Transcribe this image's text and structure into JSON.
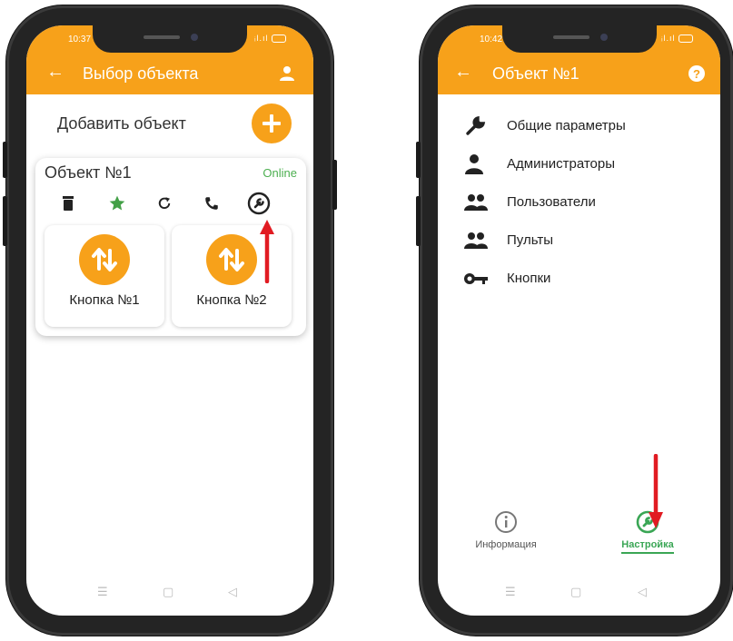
{
  "colors": {
    "accent": "#f7a11a",
    "online": "#4caf50",
    "active_tab": "#3aa655",
    "arrow": "#e11b22"
  },
  "left": {
    "status": {
      "time": "10:37"
    },
    "appbar": {
      "title": "Выбор объекта"
    },
    "add": {
      "label": "Добавить объект"
    },
    "object": {
      "name": "Объект №1",
      "status": "Online",
      "tools": [
        "trash-icon",
        "star-icon",
        "refresh-icon",
        "phone-icon",
        "wrench-icon"
      ],
      "buttons": [
        {
          "label": "Кнопка №1"
        },
        {
          "label": "Кнопка №2"
        }
      ]
    }
  },
  "right": {
    "status": {
      "time": "10:42"
    },
    "appbar": {
      "title": "Объект №1"
    },
    "menu": [
      {
        "label": "Общие параметры",
        "icon": "wrench-icon"
      },
      {
        "label": "Администраторы",
        "icon": "person-icon"
      },
      {
        "label": "Пользователи",
        "icon": "group-icon"
      },
      {
        "label": "Пульты",
        "icon": "group-icon"
      },
      {
        "label": "Кнопки",
        "icon": "key-icon"
      }
    ],
    "tabs": [
      {
        "label": "Информация",
        "icon": "info-icon"
      },
      {
        "label": "Настройка",
        "icon": "wrench-circle-icon"
      }
    ]
  }
}
